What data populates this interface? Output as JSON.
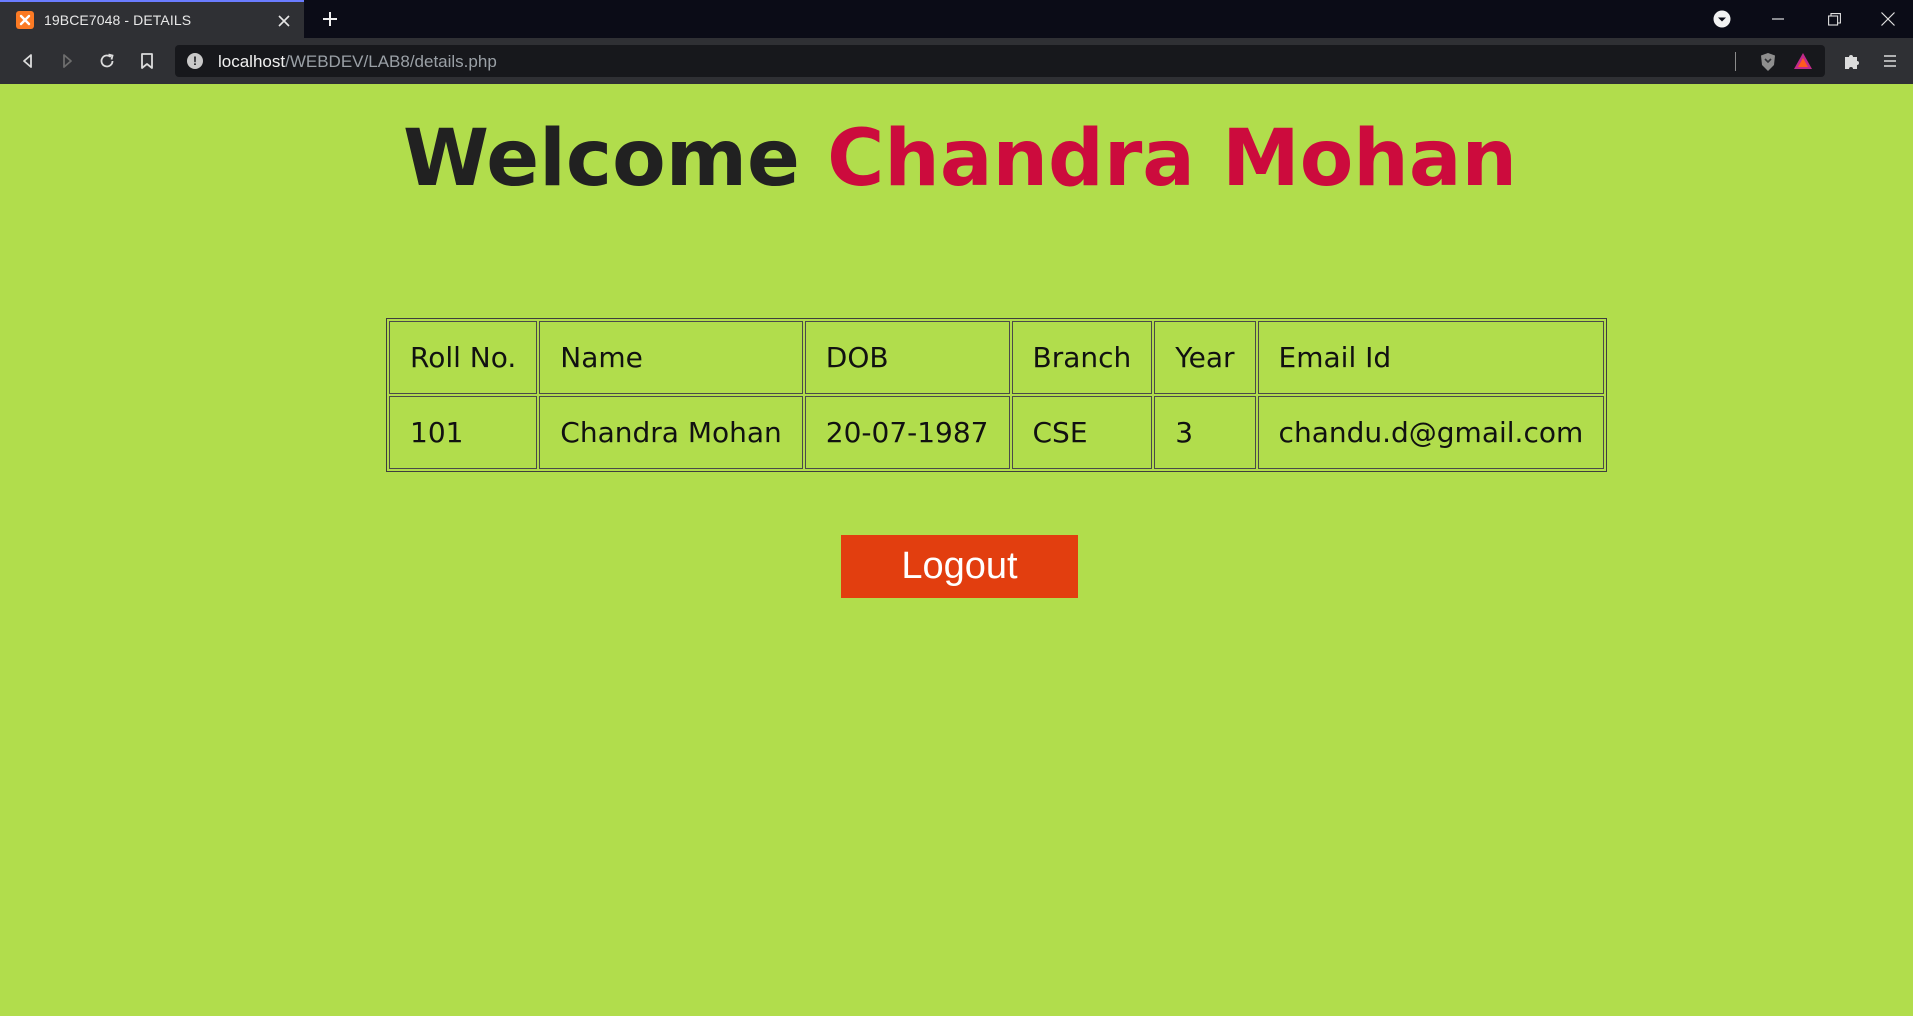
{
  "browser": {
    "tab_title": "19BCE7048 - DETAILS",
    "url_host": "localhost",
    "url_path": "/WEBDEV/LAB8/details.php"
  },
  "page": {
    "welcome_prefix": "Welcome",
    "welcome_name": "Chandra Mohan",
    "table": {
      "headers": [
        "Roll No.",
        "Name",
        "DOB",
        "Branch",
        "Year",
        "Email Id"
      ],
      "row": [
        "101",
        "Chandra Mohan",
        "20-07-1987",
        "CSE",
        "3",
        "chandu.d@gmail.com"
      ]
    },
    "logout_label": "Logout"
  },
  "colors": {
    "page_background": "#b1dd4c",
    "name_highlight": "#cc0b3d",
    "logout_button": "#e23e0f"
  }
}
